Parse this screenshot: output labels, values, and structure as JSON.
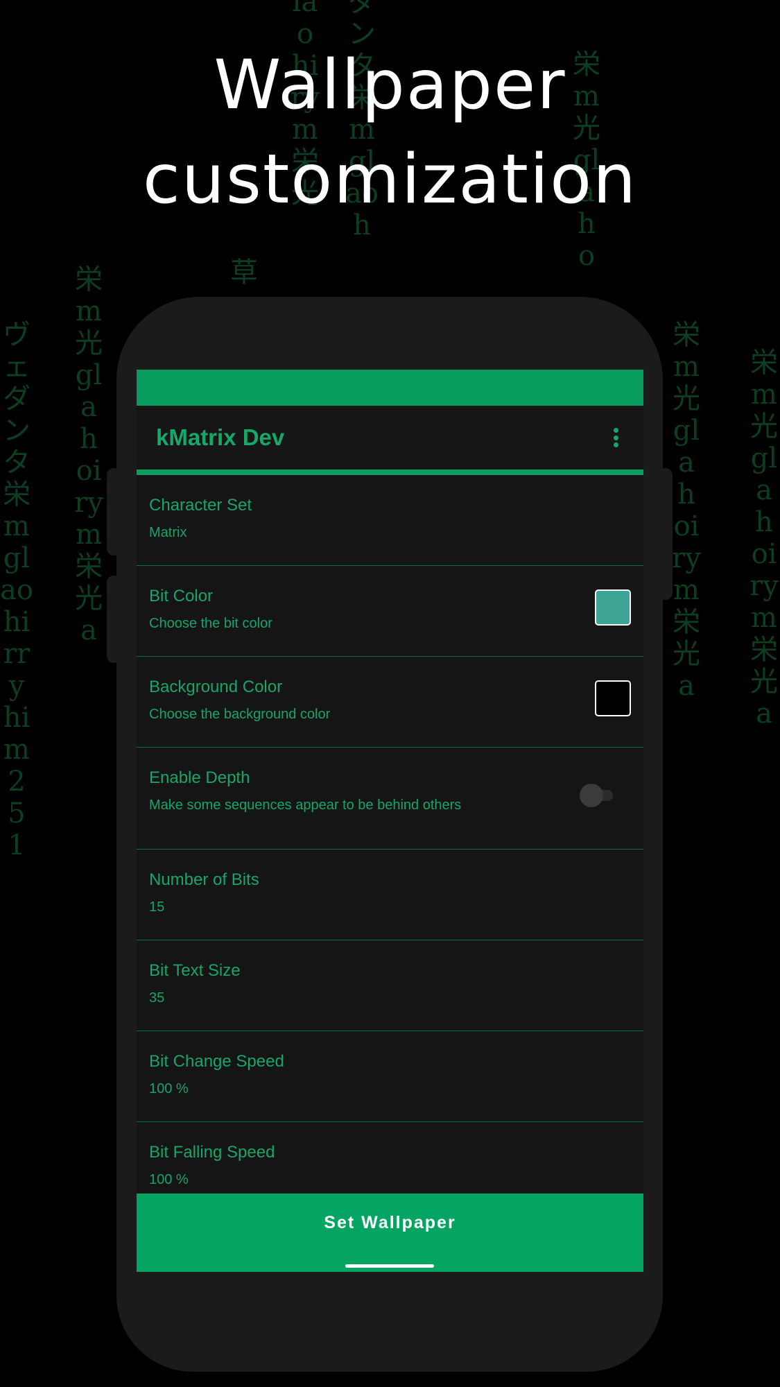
{
  "headline": {
    "line1": "Wallpaper",
    "line2": "customization"
  },
  "background_rain": [
    "ヴェダンタ栄mglaohirryhim251",
    "栄m光glahoirym栄光a",
    "草",
    "laohirym栄光",
    "ダンタ栄mglaoh",
    "栄m光glaho",
    "栄m光glahoirym栄光a",
    "栄m光glahoirym栄光a"
  ],
  "app": {
    "title": "kMatrix Dev",
    "menu_icon": "more-vert-icon",
    "accent_color": "#079b5e",
    "preferences": [
      {
        "title": "Character Set",
        "summary": "Matrix"
      },
      {
        "title": "Bit Color",
        "summary": "Choose the bit color",
        "swatch": "#3fa596"
      },
      {
        "title": "Background Color",
        "summary": "Choose the background color",
        "swatch": "#000000"
      },
      {
        "title": "Enable Depth",
        "summary": "Make some sequences appear to be behind others",
        "toggle_on": false
      },
      {
        "title": "Number of Bits",
        "summary": "15"
      },
      {
        "title": "Bit Text Size",
        "summary": "35"
      },
      {
        "title": "Bit Change Speed",
        "summary": "100 %"
      },
      {
        "title": "Bit Falling Speed",
        "summary": "100 %"
      }
    ],
    "set_wallpaper_label": "Set Wallpaper"
  }
}
